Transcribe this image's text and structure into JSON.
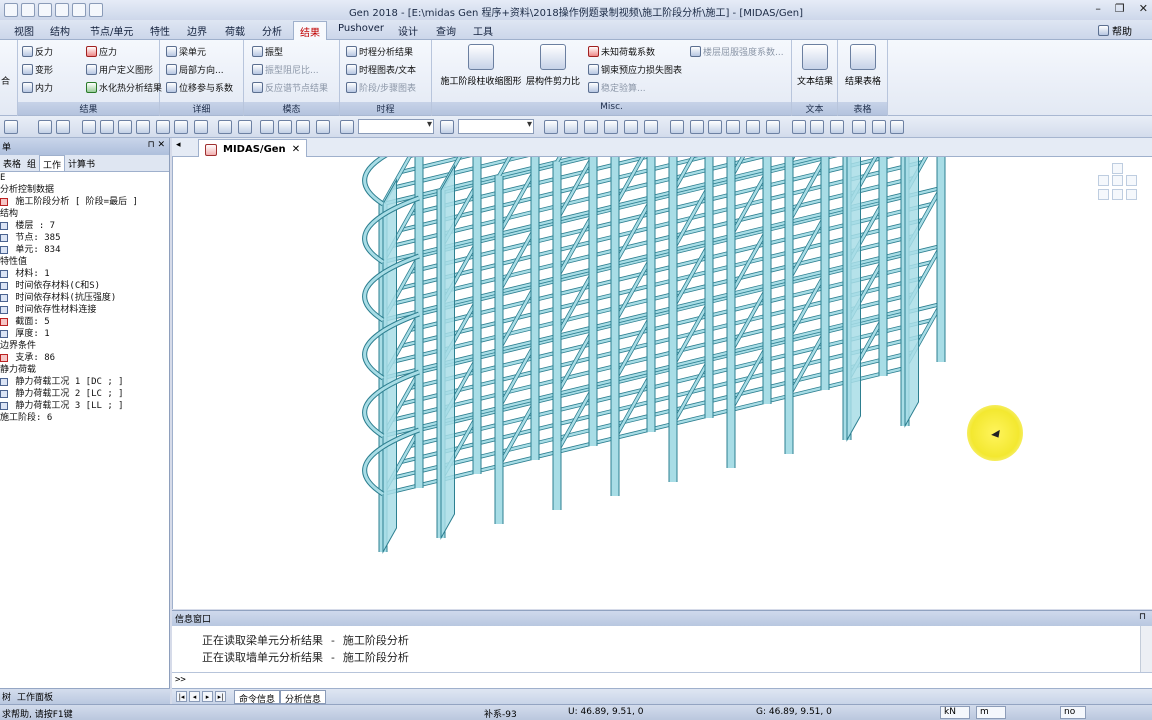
{
  "window": {
    "title": "Gen 2018 - [E:\\midas Gen 程序+资料\\2018操作例题录制视频\\施工阶段分析\\施工] - [MIDAS/Gen]"
  },
  "ribbon_tabs": [
    "视图",
    "结构",
    "节点/单元",
    "特性",
    "边界",
    "荷载",
    "分析",
    "结果",
    "Pushover",
    "设计",
    "查询",
    "工具"
  ],
  "active_tab": "结果",
  "help_label": "帮助",
  "ribbon": {
    "group_results": {
      "label": "结果",
      "items": [
        "反力",
        "应力",
        "变形",
        "用户定义图形",
        "内力",
        "水化热分析结果"
      ],
      "leading": "合"
    },
    "group_detail": {
      "label": "详细",
      "items": [
        "梁单元",
        "局部方向...",
        "位移参与系数"
      ]
    },
    "group_mode": {
      "label": "模态",
      "items": [
        "振型",
        "振型阻尼比...",
        "反应谱节点结果"
      ]
    },
    "group_timehistory": {
      "label": "时程",
      "items": [
        "时程分析结果",
        "时程图表/文本",
        "阶段/步骤图表"
      ]
    },
    "group_misc": {
      "label": "Misc.",
      "big1": "施工阶段柱收缩图形",
      "big2": "层构件剪力比",
      "items": [
        "未知荷载系数",
        "钢束预应力损失图表",
        "稳定验算...",
        "楼层屈服强度系数..."
      ]
    },
    "group_text": {
      "label": "文本",
      "big": "文本结果"
    },
    "group_table": {
      "label": "表格",
      "big": "结果表格"
    }
  },
  "left_panel": {
    "header": "单",
    "tabs": [
      "表格",
      "组",
      "工作",
      "计算书"
    ],
    "active_tab": "工作",
    "tree": [
      "E",
      "分析控制数据",
      "  施工阶段分析 [ 阶段=最后 ]",
      "结构",
      "  楼层 : 7",
      "  节点: 385",
      "  单元: 834",
      "特性值",
      "  材料: 1",
      "  时间依存材料(C和S)",
      "  时间依存材料(抗压强度)",
      "  时间依存性材料连接",
      "  截面: 5",
      "  厚度: 1",
      "边界条件",
      "  支承: 86",
      "静力荷载",
      "  静力荷载工况 1 [DC ; ]",
      "  静力荷载工况 2 [LC ; ]",
      "  静力荷载工况 3 [LL ; ]",
      "施工阶段: 6"
    ],
    "bottom_tabs": [
      "树",
      "工作面板"
    ]
  },
  "doc_tab": "MIDAS/Gen",
  "message_window": {
    "title": "信息窗口",
    "lines": [
      "正在读取梁单元分析结果 - 施工阶段分析",
      "正在读取墙单元分析结果 - 施工阶段分析"
    ],
    "prompt": ">>"
  },
  "bottom_tabs": [
    "命令信息",
    "分析信息"
  ],
  "status": {
    "help": "求帮助, 请按F1键",
    "frame": "补系-93",
    "ucs": "U: 46.89, 9.51, 0",
    "gcs": "G: 46.89, 9.51, 0",
    "unit_force": "kN",
    "unit_length": "m",
    "filter": "no"
  },
  "colors": {
    "accent_tab": "#c00000",
    "structure_fill": "#a8dde6",
    "structure_edge": "#2d7f90",
    "highlight_cursor": "#f3e830"
  }
}
